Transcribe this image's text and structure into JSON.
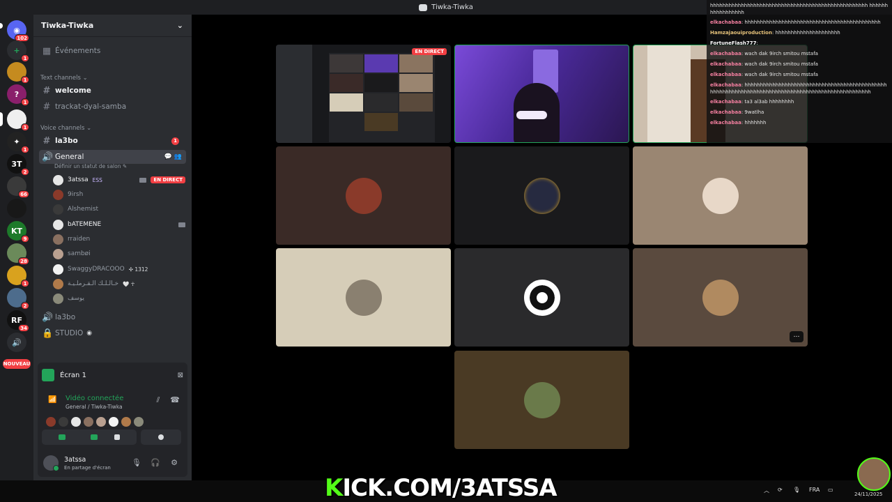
{
  "window": {
    "title": "Tiwka-Tiwka"
  },
  "servers": [
    {
      "name": "Discord home",
      "badge": "102",
      "label": ""
    },
    {
      "name": "add server",
      "badge": "1",
      "label": "+"
    },
    {
      "name": "server 3",
      "badge": "1",
      "label": ""
    },
    {
      "name": "server 4",
      "badge": "1",
      "label": "?"
    },
    {
      "name": "server 5",
      "badge": "1",
      "label": ""
    },
    {
      "name": "server 6",
      "badge": "1",
      "label": "✦"
    },
    {
      "name": "server 7",
      "badge": "2",
      "label": "3T"
    },
    {
      "name": "server 8",
      "badge": "66",
      "label": ""
    },
    {
      "name": "server 9",
      "badge": "",
      "label": ""
    },
    {
      "name": "server 10",
      "badge": "9",
      "label": "KT"
    },
    {
      "name": "server 11",
      "badge": "28",
      "label": ""
    },
    {
      "name": "server 12",
      "badge": "1",
      "label": ""
    },
    {
      "name": "server 13",
      "badge": "2",
      "label": ""
    },
    {
      "name": "server 14",
      "badge": "34",
      "label": "RF"
    },
    {
      "name": "server 15",
      "badge": "",
      "label": ""
    }
  ],
  "new_badge": "NOUVEAU",
  "sidebar": {
    "server_name": "Tiwka-Tiwka",
    "events": "Événements",
    "text_category": "Text channels ⌄",
    "text_channels": [
      "welcome",
      "trackat-dyal-samba"
    ],
    "voice_category": "Voice channels ⌄",
    "la3bo_text": "la3bo",
    "la3bo_count": "1",
    "general": "General",
    "general_status": "Définir un statut de salon ✎",
    "voice_users": [
      {
        "name": "3atssa",
        "tag": "ESS",
        "live": "EN DIRECT"
      },
      {
        "name": "9irsh"
      },
      {
        "name": "Alshemist"
      },
      {
        "name": "bATEMENE"
      },
      {
        "name": "rraiden"
      },
      {
        "name": "sambøi"
      },
      {
        "name": "SwaggyDRACOOO",
        "tag": "✣ 1312"
      },
      {
        "name": "خـالـلـك الـقـرملـيـة",
        "tag": "🤍 ☥"
      },
      {
        "name": "يوسف"
      }
    ],
    "la3bo_voice": "la3bo",
    "studio": "STUDIO"
  },
  "voice_panel": {
    "screen_label": "Écran 1",
    "connected": "Vidéo connectée",
    "location": "General / Tiwka-Tiwka",
    "user": "3atssa",
    "user_status": "En partage d'écran"
  },
  "grid": {
    "live_label": "EN DIRECT"
  },
  "chat": [
    {
      "user": "",
      "text": "hhhhhhhhhhhhhhhhhhhhhhhhhhhhhhhhhhhhhhhhhhhhhhhhhhh hhhhhhhhhhhhhhhhh",
      "color": "#e6e6e6"
    },
    {
      "user": "elkachabaa",
      "text": ": hhhhhhhhhhhhhhhhhhhhhhhhhhhhhhhhhhhhhhhhhhhh",
      "color": "#f47fa0"
    },
    {
      "user": "Hamzajaouiproduction",
      "text": ": hhhhhhhhhhhhhhhhhhhhh",
      "color": "#e6c27a"
    },
    {
      "user": "FortuneFlash777",
      "text": ":",
      "color": "#ffffff"
    },
    {
      "user": "elkachabaa",
      "text": ": wach dak 9irch smitou mstafa",
      "color": "#f47fa0"
    },
    {
      "user": "elkachabaa",
      "text": ": wach dak 9irch smitou mstafa",
      "color": "#f47fa0"
    },
    {
      "user": "elkachabaa",
      "text": ": wach dak 9irch smitou mstafa",
      "color": "#f47fa0"
    },
    {
      "user": "elkachabaa",
      "text": ": hhhhhhhhhhhhhhhhhhhhhhhhhhhhhhhhhhhhhhhhhhhhhhhhhhhhhhhhhhhhhhhhhhhhhhhhhhhhhhhhhhhhhhhhhhhhhhhhhh",
      "color": "#f47fa0"
    },
    {
      "user": "elkachabaa",
      "text": ": ta3 al3ab hhhhhhhh",
      "color": "#f47fa0"
    },
    {
      "user": "elkachabaa",
      "text": ": 9watlha",
      "color": "#f47fa0"
    },
    {
      "user": "elkachabaa",
      "text": ": hhhhhhh",
      "color": "#f47fa0"
    }
  ],
  "overlay": {
    "kick_k": "K",
    "kick_rest": "ICK.COM/3ATSSA"
  },
  "tray": {
    "lang": "FRA",
    "date": "24/11/2025"
  },
  "colors": {
    "green": "#23a55a",
    "red": "#f23f43",
    "kick": "#53fc18"
  }
}
